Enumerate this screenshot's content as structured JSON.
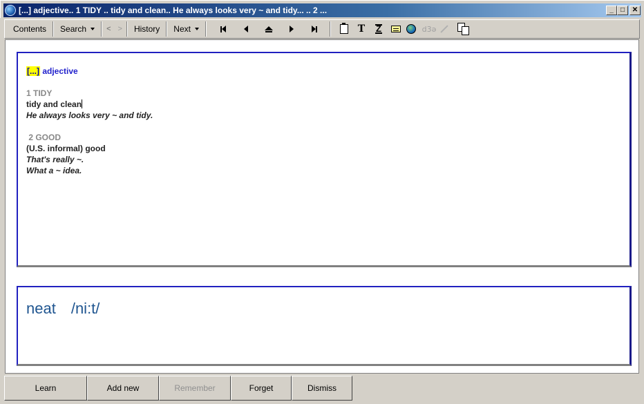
{
  "window": {
    "title": "[...] adjective..  1 TIDY .. tidy and clean.. He always looks very ~ and tidy... ..  2 ...",
    "controls": [
      "minimize",
      "maximize",
      "close"
    ]
  },
  "toolbar": {
    "contents": "Contents",
    "search": "Search",
    "back": "<",
    "forward": ">",
    "history": "History",
    "next": "Next",
    "nav_icons": [
      "first-icon",
      "previous-icon",
      "up-icon",
      "next-icon",
      "last-icon"
    ],
    "tool_icons": [
      "clipboard-icon",
      "text-icon",
      "z-icon",
      "card-icon",
      "globe-icon",
      "ipa-icon",
      "wand-icon",
      "copy-icon"
    ],
    "ipa_label": "d3ə"
  },
  "definition": {
    "placeholder": "[...]",
    "pos": "adjective",
    "senses": [
      {
        "title": "1 TIDY",
        "definition": "tidy and clean",
        "examples": [
          "He always looks very ~ and tidy."
        ]
      },
      {
        "title": " 2 GOOD",
        "definition": "(U.S. informal) good",
        "examples": [
          "That's really ~.",
          "What a ~ idea."
        ]
      }
    ]
  },
  "headword": {
    "word": "neat",
    "pronunciation": "/ni:t/"
  },
  "buttons": {
    "learn": "Learn",
    "add_new": "Add new",
    "remember": "Remember",
    "forget": "Forget",
    "dismiss": "Dismiss"
  }
}
